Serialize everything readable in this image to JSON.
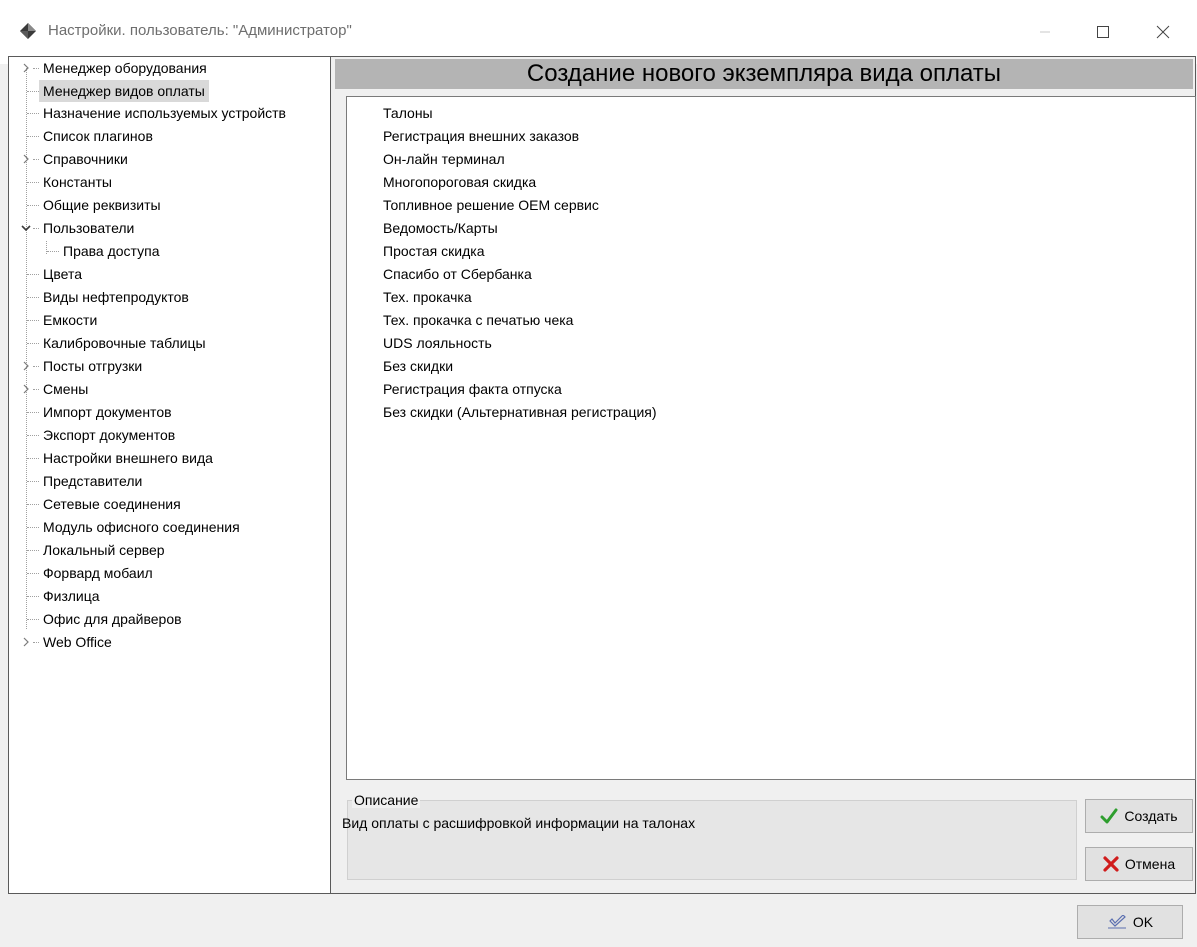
{
  "window": {
    "title": "Настройки. пользователь: \"Администратор\""
  },
  "tree": {
    "items": [
      {
        "label": "Менеджер оборудования",
        "expandable": "collapsed",
        "level": 0
      },
      {
        "label": "Менеджер видов оплаты",
        "level": 0,
        "selected": true
      },
      {
        "label": "Назначение используемых устройств",
        "level": 0
      },
      {
        "label": "Список плагинов",
        "level": 0
      },
      {
        "label": "Справочники",
        "expandable": "collapsed",
        "level": 0
      },
      {
        "label": "Константы",
        "level": 0
      },
      {
        "label": "Общие реквизиты",
        "level": 0
      },
      {
        "label": "Пользователи",
        "expandable": "expanded",
        "level": 0
      },
      {
        "label": "Права доступа",
        "level": 1
      },
      {
        "label": "Цвета",
        "level": 0
      },
      {
        "label": "Виды нефтепродуктов",
        "level": 0
      },
      {
        "label": "Емкости",
        "level": 0
      },
      {
        "label": "Калибровочные таблицы",
        "level": 0
      },
      {
        "label": "Посты отгрузки",
        "expandable": "collapsed",
        "level": 0
      },
      {
        "label": "Смены",
        "expandable": "collapsed",
        "level": 0
      },
      {
        "label": "Импорт документов",
        "level": 0
      },
      {
        "label": "Экспорт документов",
        "level": 0
      },
      {
        "label": "Настройки внешнего вида",
        "level": 0
      },
      {
        "label": "Представители",
        "level": 0
      },
      {
        "label": "Сетевые соединения",
        "level": 0
      },
      {
        "label": "Модуль офисного соединения",
        "level": 0
      },
      {
        "label": "Локальный сервер",
        "level": 0
      },
      {
        "label": "Форвард мобаил",
        "level": 0
      },
      {
        "label": "Физлица",
        "level": 0
      },
      {
        "label": "Офис для драйверов",
        "level": 0
      },
      {
        "label": "Web Office",
        "expandable": "collapsed",
        "level": 0
      }
    ]
  },
  "main": {
    "header": "Создание нового экземпляра вида оплаты",
    "payment_types": [
      "Талоны",
      "Регистрация внешних заказов",
      "Он-лайн терминал",
      "Многопороговая скидка",
      "Топливное решение OEM сервис",
      "Ведомость/Карты",
      "Простая скидка",
      "Спасибо от Сбербанка",
      "Тех. прокачка",
      "Тех. прокачка с печатью чека",
      "UDS лояльность",
      "Без скидки",
      "Регистрация факта отпуска",
      "Без скидки (Альтернативная регистрация)"
    ],
    "description": {
      "legend": "Описание",
      "text": "Вид оплаты с расшифровкой информации на талонах"
    },
    "create_label": "Создать",
    "cancel_label": "Отмена"
  },
  "footer": {
    "ok_label": "OK"
  },
  "colors": {
    "selection": "#d9d9d9",
    "header_bg": "#b4b4b4",
    "create_check": "#2e9e2e",
    "cancel_x": "#d01c1c"
  }
}
